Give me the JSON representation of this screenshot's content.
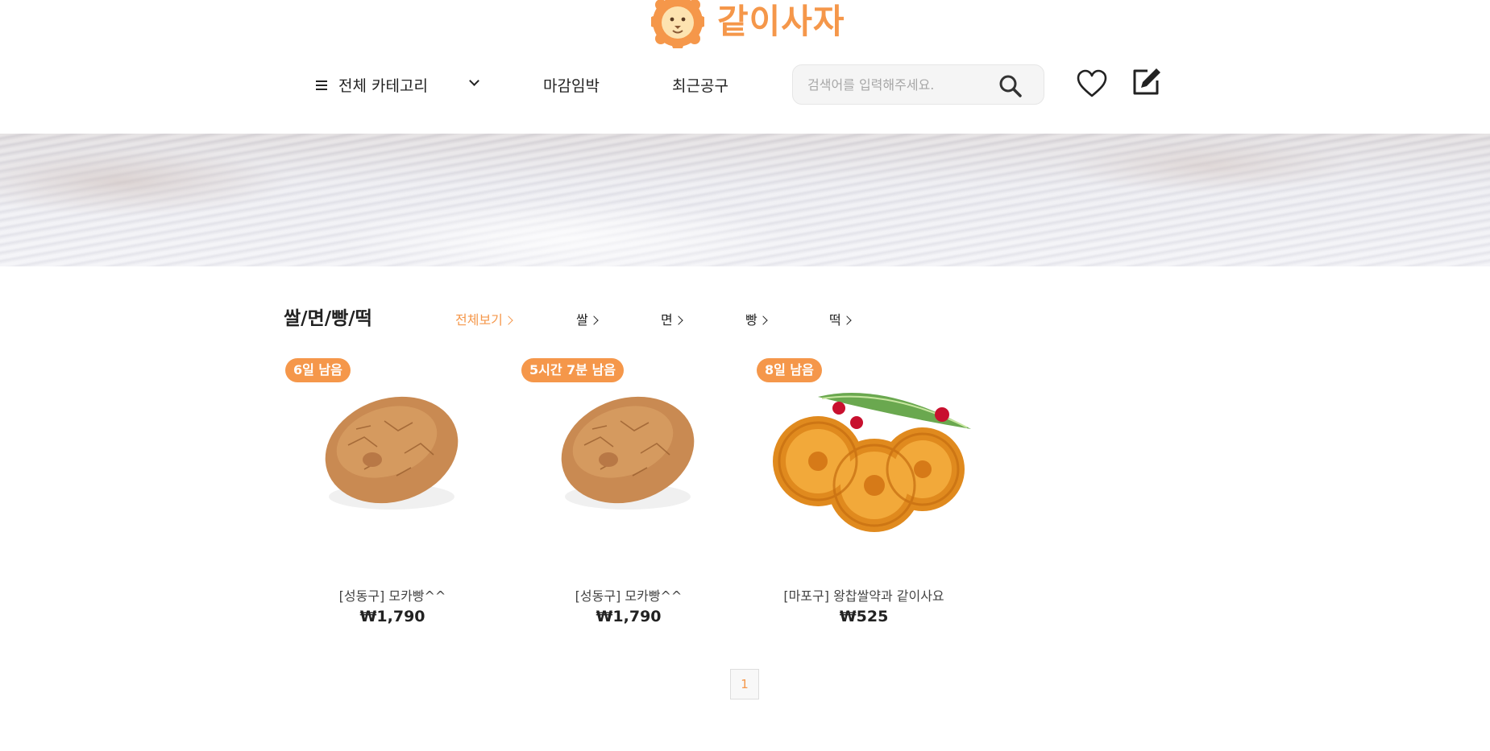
{
  "brand": {
    "name": "같이사자",
    "accent": "#f5974a"
  },
  "nav": {
    "category_label": "전체 카테고리",
    "links": [
      "마감임박",
      "최근공구"
    ],
    "search_placeholder": "검색어를 입력해주세요.",
    "search_value": ""
  },
  "section": {
    "title": "쌀/면/빵/떡",
    "tabs": [
      "전체보기",
      "쌀",
      "면",
      "빵",
      "떡"
    ],
    "active_tab": "전체보기"
  },
  "products": [
    {
      "badge": "6일 남음",
      "name": "[성동구] 모카빵^^",
      "price": "₩1,790",
      "image": "mocha-bread"
    },
    {
      "badge": "5시간 7분 남음",
      "name": "[성동구] 모카빵^^",
      "price": "₩1,790",
      "image": "mocha-bread"
    },
    {
      "badge": "8일 남음",
      "name": "[마포구] 왕찹쌀약과 같이사요",
      "price": "₩525",
      "image": "yakgwa"
    }
  ],
  "pagination": {
    "current": "1"
  },
  "icons": [
    "lion-logo-icon",
    "hamburger-icon",
    "chevron-down-icon",
    "search-icon",
    "heart-icon",
    "edit-icon",
    "chevron-right-icon"
  ]
}
